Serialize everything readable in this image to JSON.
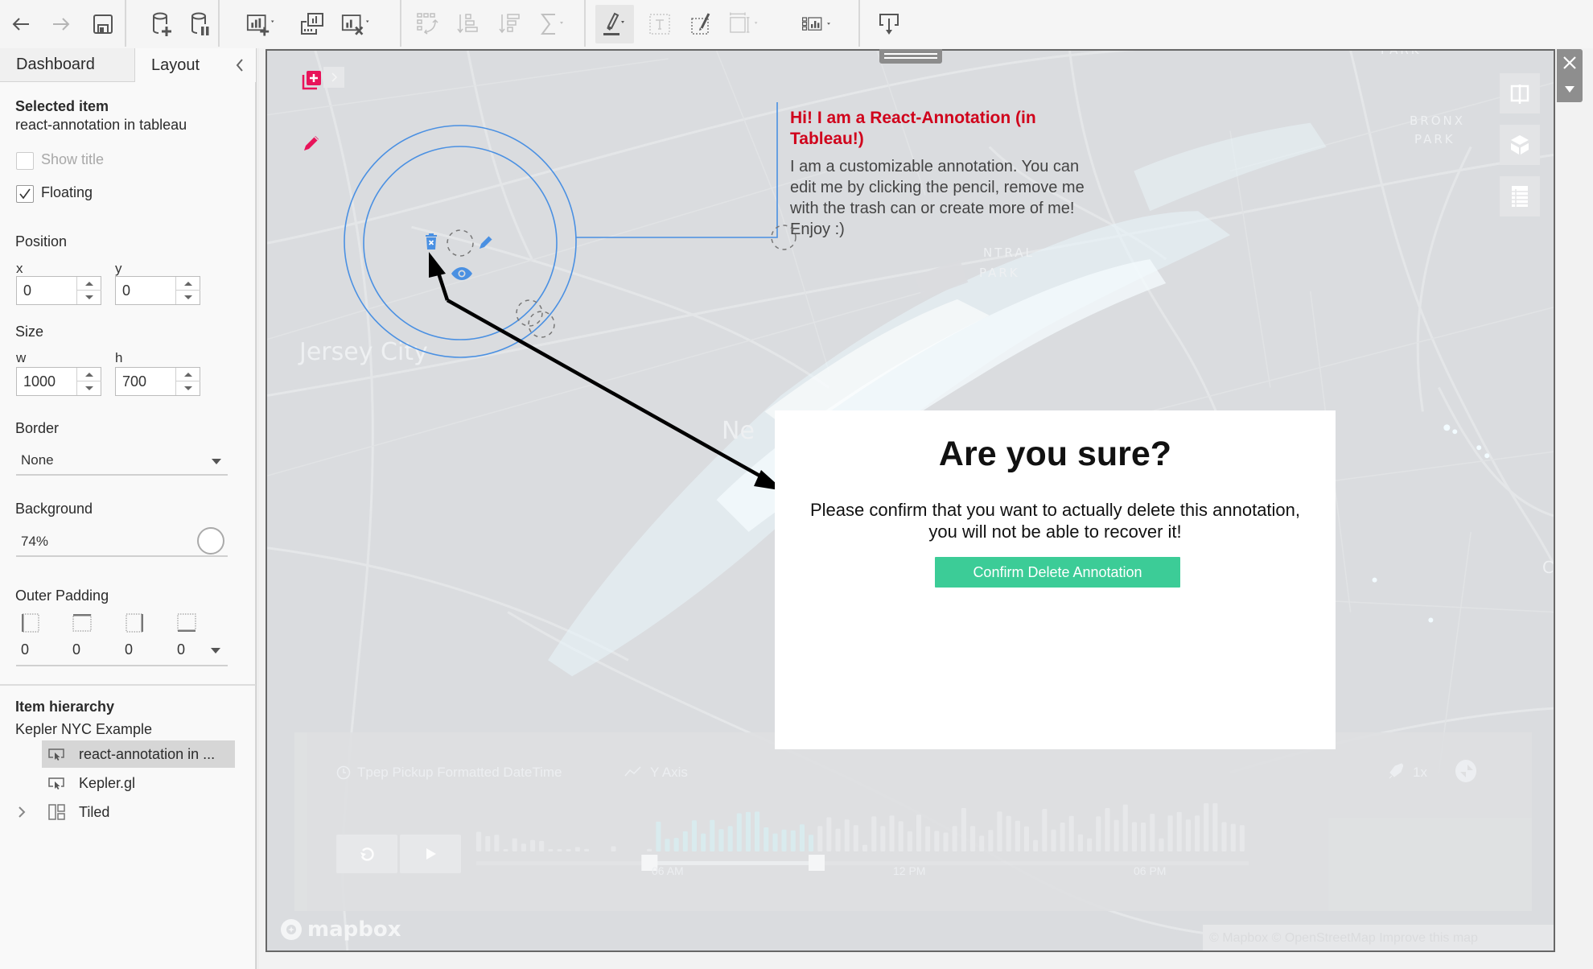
{
  "toolbar": {
    "buttons": [
      {
        "name": "undo",
        "icon": "arrow-left-icon",
        "enabled": true
      },
      {
        "name": "redo",
        "icon": "arrow-right-icon",
        "enabled": false
      },
      {
        "name": "save",
        "icon": "save-icon",
        "enabled": true
      },
      {
        "name": "new-data-source",
        "icon": "database-add-icon",
        "enabled": true
      },
      {
        "name": "pause-auto-updates",
        "icon": "database-pause-icon",
        "enabled": true
      },
      {
        "name": "new-worksheet",
        "icon": "new-sheet-icon",
        "enabled": true
      },
      {
        "name": "duplicate-sheet",
        "icon": "duplicate-sheet-icon",
        "enabled": true
      },
      {
        "name": "clear-sheet",
        "icon": "clear-sheet-icon",
        "enabled": true
      },
      {
        "name": "swap-rows-columns",
        "icon": "swap-icon",
        "enabled": false
      },
      {
        "name": "sort-ascending",
        "icon": "sort-asc-icon",
        "enabled": false
      },
      {
        "name": "sort-descending",
        "icon": "sort-desc-icon",
        "enabled": false
      },
      {
        "name": "totals",
        "icon": "sigma-icon",
        "enabled": false
      },
      {
        "name": "highlight",
        "icon": "highlighter-icon",
        "enabled": true,
        "active": true
      },
      {
        "name": "text-labels",
        "icon": "text-box-icon",
        "enabled": false
      },
      {
        "name": "format-workbook",
        "icon": "brush-icon",
        "enabled": true
      },
      {
        "name": "fit",
        "icon": "fit-icon",
        "enabled": false
      },
      {
        "name": "show-me",
        "icon": "show-me-icon",
        "enabled": true
      },
      {
        "name": "present",
        "icon": "present-icon",
        "enabled": true
      }
    ]
  },
  "left_panel": {
    "tabs": [
      {
        "label": "Dashboard",
        "active": false
      },
      {
        "label": "Layout",
        "active": true
      }
    ],
    "selected_item_heading": "Selected item",
    "selected_item_name": "react-annotation in tableau",
    "show_title": {
      "label": "Show title",
      "checked": false,
      "enabled": false
    },
    "floating": {
      "label": "Floating",
      "checked": true,
      "enabled": true
    },
    "position": {
      "heading": "Position",
      "x_label": "x",
      "x_value": "0",
      "y_label": "y",
      "y_value": "0"
    },
    "size": {
      "heading": "Size",
      "w_label": "w",
      "w_value": "1000",
      "h_label": "h",
      "h_value": "700"
    },
    "border": {
      "heading": "Border",
      "value": "None"
    },
    "background": {
      "heading": "Background",
      "value": "74%",
      "color": "#ffffff"
    },
    "outer_padding": {
      "heading": "Outer Padding",
      "left": "0",
      "top": "0",
      "right": "0",
      "bottom": "0"
    },
    "hierarchy": {
      "heading": "Item hierarchy",
      "root": "Kepler NYC Example",
      "items": [
        {
          "label": "react-annotation in ...",
          "icon": "extension-icon",
          "selected": true
        },
        {
          "label": "Kepler.gl",
          "icon": "extension-icon",
          "selected": false
        },
        {
          "label": "Tiled",
          "icon": "tiled-container-icon",
          "selected": false,
          "expandable": true
        }
      ]
    }
  },
  "map": {
    "labels": {
      "park_top": "PARK",
      "bronx_park_1": "BRONX",
      "bronx_park_2": "PARK",
      "central_park_1": "NTRAL",
      "central_park_2": "PARK",
      "jersey_city": "Jersey City",
      "new_york_partial": "Ne",
      "right_partial": "C"
    },
    "annotation": {
      "title": "Hi! I am a React-Annotation (in Tableau!)",
      "body": "I am a customizable annotation. You can edit me by clicking the pencil, remove me with the trash can or create more of me! Enjoy :)",
      "title_color": "#d0021b",
      "accent_color": "#4a90e2"
    },
    "timeline": {
      "field": "Tpep Pickup Formatted DateTime",
      "y_axis": "Y Axis",
      "speed": "1x",
      "ticks": [
        "06 AM",
        "12 PM",
        "06 PM"
      ],
      "selection_start": "06 AM",
      "histogram": [
        0.45,
        0.35,
        0.38,
        0.04,
        0.3,
        0.18,
        0.26,
        0.24,
        0.04,
        0.04,
        0.02,
        0.1,
        0.06,
        0.0,
        0.0,
        0.12,
        0.0,
        0.0,
        0.0,
        0.06,
        0.68,
        0.29,
        0.31,
        0.46,
        0.71,
        0.41,
        0.72,
        0.51,
        0.58,
        0.87,
        0.9,
        0.91,
        0.55,
        0.41,
        0.5,
        0.48,
        0.62,
        0.38,
        0.58,
        0.78,
        0.52,
        0.73,
        0.6,
        0.15,
        0.8,
        0.58,
        0.82,
        0.69,
        0.46,
        0.84,
        0.57,
        0.47,
        0.43,
        0.58,
        0.99,
        0.58,
        0.36,
        0.49,
        0.91,
        0.81,
        0.7,
        0.57,
        0.26,
        0.97,
        0.5,
        0.66,
        0.81,
        0.39,
        0.3,
        0.8,
        0.99,
        0.72,
        1.07,
        0.67,
        0.66,
        0.86,
        0.3,
        0.82,
        0.9,
        0.73,
        0.82,
        1.1,
        1.1,
        0.67,
        0.63,
        0.6
      ],
      "selected_range": [
        20,
        37
      ]
    },
    "attribution": "© Mapbox © OpenStreetMap  Improve this map",
    "logo": "mapbox"
  },
  "dialog": {
    "title": "Are you sure?",
    "message_line1": "Please confirm that you want to actually delete this annotation,",
    "message_line2": "you will not be able to recover it!",
    "confirm_label": "Confirm Delete Annotation",
    "confirm_color": "#3ccc97"
  },
  "frame_controls": {
    "close": "X"
  }
}
